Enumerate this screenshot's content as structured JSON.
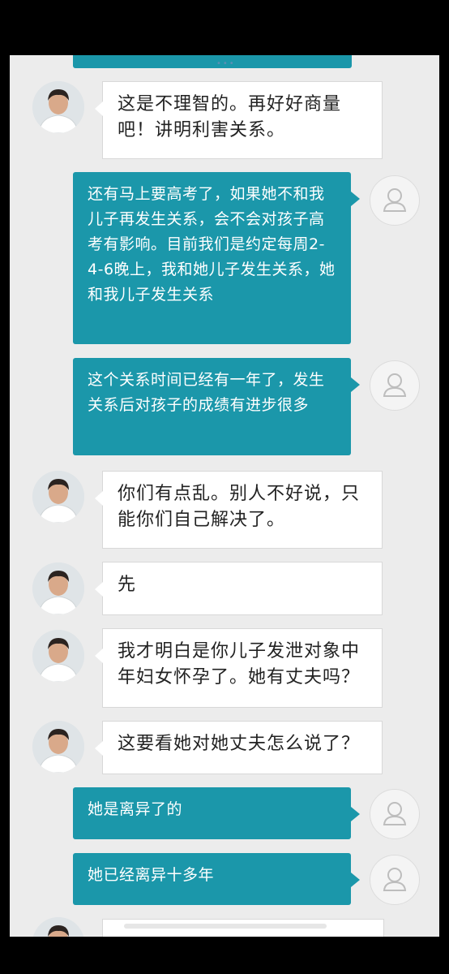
{
  "conversation": {
    "messages": [
      {
        "side": "doctor",
        "text": "这是不理智的。再好好商量吧！讲明利害关系。"
      },
      {
        "side": "user",
        "text": "还有马上要高考了，如果她不和我儿子再发生关系，会不会对孩子高考有影响。目前我们是约定每周2-4-6晚上，我和她儿子发生关系，她和我儿子发生关系"
      },
      {
        "side": "user",
        "text": "这个关系时间已经有一年了，发生关系后对孩子的成绩有进步很多"
      },
      {
        "side": "doctor",
        "text": "你们有点乱。别人不好说，只能你们自己解决了。"
      },
      {
        "side": "doctor",
        "text": "先"
      },
      {
        "side": "doctor",
        "text": "我才明白是你儿子发泄对象中年妇女怀孕了。她有丈夫吗？"
      },
      {
        "side": "doctor",
        "text": "这要看她对她丈夫怎么说了？"
      },
      {
        "side": "user",
        "text": "她是离异了的"
      },
      {
        "side": "user",
        "text": "她已经离异十多年"
      }
    ],
    "top_dots": "•••"
  },
  "colors": {
    "outgoing_bubble": "#1b97aa",
    "incoming_bubble": "#ffffff",
    "background": "#ececec"
  },
  "icons": {
    "doctor_avatar": "doctor-avatar-icon",
    "user_avatar": "user-silhouette-icon"
  }
}
